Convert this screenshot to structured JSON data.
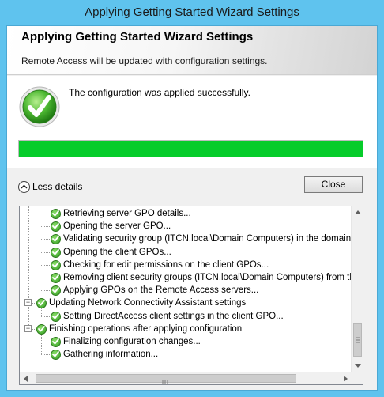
{
  "window": {
    "title": "Applying Getting Started Wizard Settings"
  },
  "header": {
    "title": "Applying Getting Started Wizard Settings",
    "subtitle": "Remote Access will be updated with configuration settings."
  },
  "status": {
    "message": "The configuration was applied successfully.",
    "progress_percent": 100,
    "colors": {
      "progress": "#06cc2a",
      "check": "#3aa82a"
    }
  },
  "details": {
    "toggle_label": "Less details",
    "close_label": "Close"
  },
  "log": {
    "items": [
      {
        "text": "Retrieving server GPO details...",
        "level": 2
      },
      {
        "text": "Opening the server GPO...",
        "level": 2
      },
      {
        "text": "Validating security group (ITCN.local\\Domain Computers) in the domain...",
        "level": 2
      },
      {
        "text": "Opening the client GPOs...",
        "level": 2
      },
      {
        "text": "Checking for edit permissions on the client GPOs...",
        "level": 2
      },
      {
        "text": "Removing client security groups (ITCN.local\\Domain Computers) from the D",
        "level": 2
      },
      {
        "text": "Applying GPOs on the Remote Access servers...",
        "level": 2
      },
      {
        "text": "Updating Network Connectivity Assistant settings",
        "level": 1
      },
      {
        "text": "Setting DirectAccess client settings in the client GPO...",
        "level": 2
      },
      {
        "text": "Finishing operations after applying configuration",
        "level": 1
      },
      {
        "text": "Finalizing configuration changes...",
        "level": 2
      },
      {
        "text": "Gathering information...",
        "level": 2
      }
    ]
  }
}
